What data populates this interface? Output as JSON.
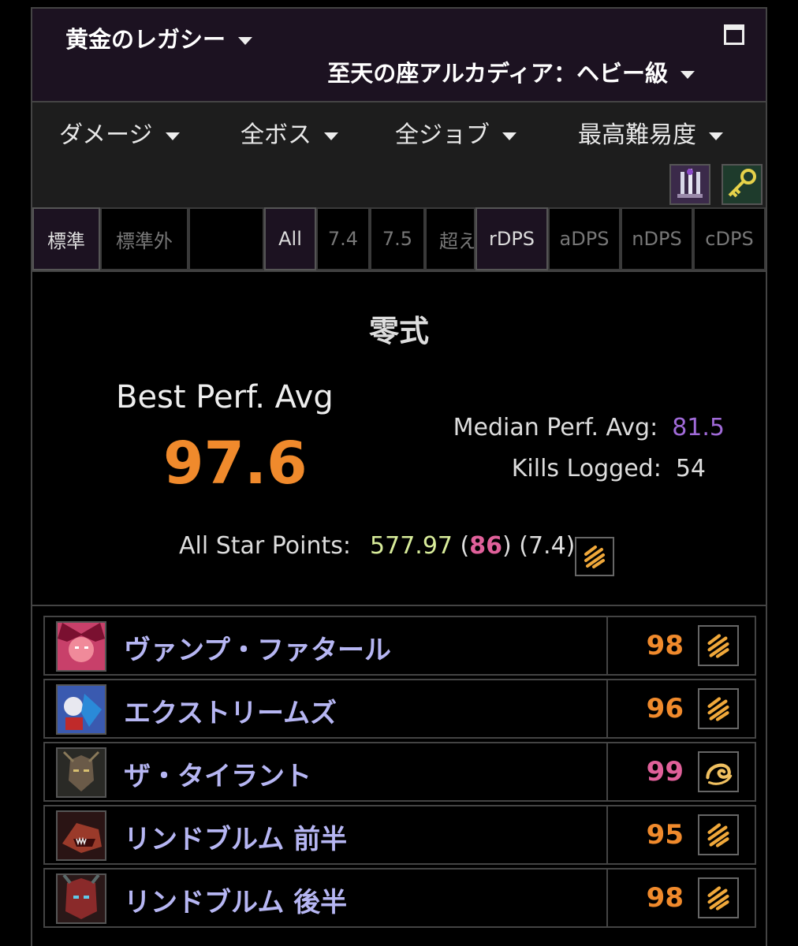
{
  "header": {
    "guild": "黄金のレガシー",
    "raid_tier": "至天の座アルカディア：ヘビー級"
  },
  "filters": {
    "metric": "ダメージ",
    "boss": "全ボス",
    "job": "全ジョブ",
    "difficulty": "最高難易度"
  },
  "tabs": {
    "partition": [
      "標準",
      "標準外"
    ],
    "version": [
      "All",
      "7.4",
      "7.5",
      "超え"
    ],
    "role": [
      "rDPS",
      "aDPS",
      "nDPS",
      "cDPS"
    ]
  },
  "summary": {
    "mode": "零式",
    "best_label": "Best Perf. Avg",
    "best_value": "97.6",
    "median_label": "Median Perf. Avg:",
    "median_value": "81.5",
    "kills_label": "Kills Logged:",
    "kills_value": "54",
    "allstar_label": "All Star Points:",
    "allstar_points": "577.97",
    "allstar_rank": "86",
    "allstar_patch": "(7.4)"
  },
  "colors": {
    "orange": "#f08a2c",
    "pink": "#e0609a",
    "purple": "#a06ad8",
    "boss_name": "#b6b6f3"
  },
  "bosses": [
    {
      "name": "ヴァンプ・ファタール",
      "score": "98",
      "medal": "stripes-icon",
      "color": "#f08a2c"
    },
    {
      "name": "エクストリームズ",
      "score": "96",
      "medal": "stripes-icon",
      "color": "#f08a2c"
    },
    {
      "name": "ザ・タイラント",
      "score": "99",
      "medal": "swirl-icon",
      "color": "#e0609a"
    },
    {
      "name": "リンドブルム 前半",
      "score": "95",
      "medal": "stripes-icon",
      "color": "#f08a2c"
    },
    {
      "name": "リンドブルム 後半",
      "score": "98",
      "medal": "stripes-icon",
      "color": "#f08a2c"
    }
  ]
}
